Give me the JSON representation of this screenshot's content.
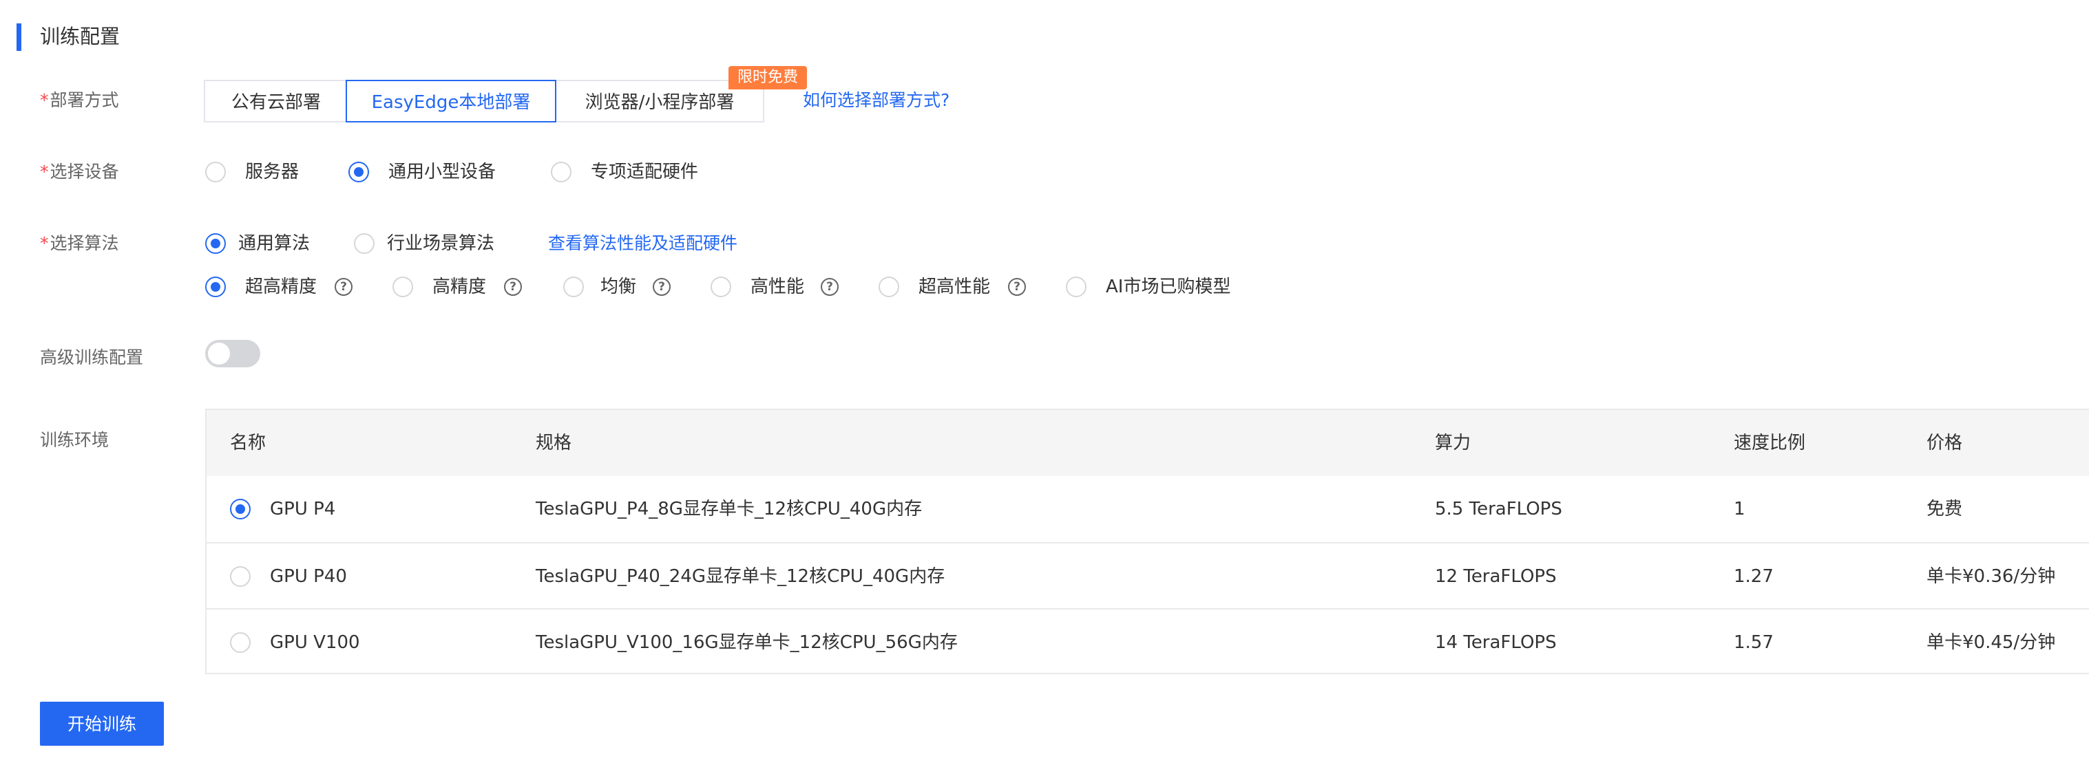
{
  "section_title": "训练配置",
  "labels": {
    "deploy": "部署方式",
    "device": "选择设备",
    "algorithm": "选择算法",
    "advanced": "高级训练配置",
    "env": "训练环境",
    "required_mark": "*"
  },
  "deploy": {
    "tabs": [
      "公有云部署",
      "EasyEdge本地部署",
      "浏览器/小程序部署"
    ],
    "selected": "EasyEdge本地部署",
    "badge": "限时免费",
    "help_link": "如何选择部署方式?"
  },
  "device": {
    "options": [
      "服务器",
      "通用小型设备",
      "专项适配硬件"
    ],
    "selected": "通用小型设备"
  },
  "algorithm": {
    "types": [
      "通用算法",
      "行业场景算法"
    ],
    "selected_type": "通用算法",
    "link": "查看算法性能及适配硬件",
    "precision_options": [
      "超高精度",
      "高精度",
      "均衡",
      "高性能",
      "超高性能",
      "AI市场已购模型"
    ],
    "selected_precision": "超高精度",
    "help_icon": "?"
  },
  "advanced_toggle": {
    "enabled": false
  },
  "env_table": {
    "headers": [
      "名称",
      "规格",
      "算力",
      "速度比例",
      "价格"
    ],
    "rows": [
      {
        "name": "GPU P4",
        "spec": "TeslaGPU_P4_8G显存单卡_12核CPU_40G内存",
        "power": "5.5 TeraFLOPS",
        "ratio": "1",
        "price": "免费",
        "selected": true
      },
      {
        "name": "GPU P40",
        "spec": "TeslaGPU_P40_24G显存单卡_12核CPU_40G内存",
        "power": "12 TeraFLOPS",
        "ratio": "1.27",
        "price": "单卡¥0.36/分钟",
        "selected": false
      },
      {
        "name": "GPU V100",
        "spec": "TeslaGPU_V100_16G显存单卡_12核CPU_56G内存",
        "power": "14 TeraFLOPS",
        "ratio": "1.57",
        "price": "单卡¥0.45/分钟",
        "selected": false
      }
    ]
  },
  "start_button": "开始训练",
  "colors": {
    "accent": "#2468f2",
    "badge": "#ff7d3c",
    "required": "#f5484d"
  }
}
